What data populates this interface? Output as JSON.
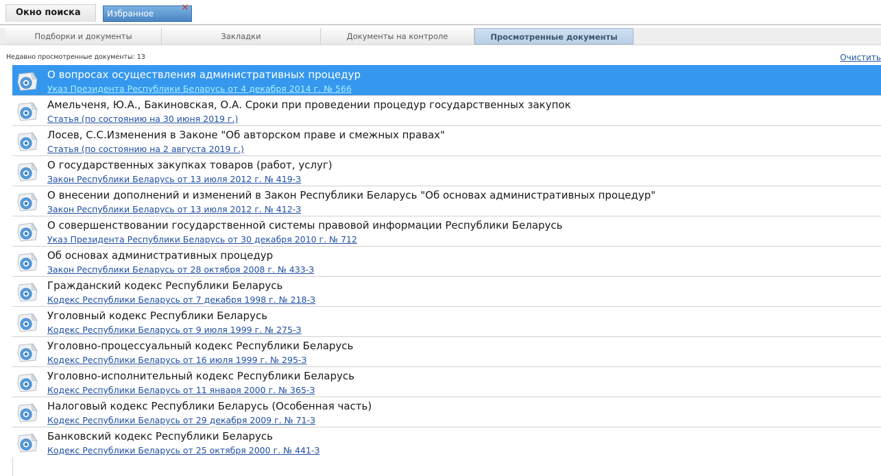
{
  "window_tabs": {
    "search": "Окно поиска",
    "favorites": "Избранное",
    "close_icon": "close-icon"
  },
  "sub_tabs": [
    {
      "label": "Подборки и документы"
    },
    {
      "label": "Закладки"
    },
    {
      "label": "Документы на контроле"
    },
    {
      "label": "Просмотренные документы",
      "active": true
    }
  ],
  "header": {
    "recent_label": "Недавно просмотренные документы: 13",
    "clear_link": "Очистить"
  },
  "documents": [
    {
      "title": "О вопросах осуществления административных процедур",
      "sub": "Указ Президента Республики Беларусь от 4 декабря 2014 г. № 566",
      "selected": true
    },
    {
      "title": "Амельченя, Ю.А., Бакиновская, О.А. Сроки при проведении процедур государственных закупок",
      "sub": "Статья (по состоянию на 30 июня 2019 г.)"
    },
    {
      "title": "Лосев, С.С.Изменения в Законе \"Об авторском праве и смежных правах\"",
      "sub": "Статья (по состоянию на 2 августа 2019 г.)"
    },
    {
      "title": "О государственных закупках товаров (работ, услуг)",
      "sub": "Закон Республики Беларусь от 13 июля 2012 г. № 419-З"
    },
    {
      "title": "О внесении дополнений и изменений в Закон Республики Беларусь \"Об основах административных процедур\"",
      "sub": "Закон Республики Беларусь от 13 июля 2012 г. № 412-З"
    },
    {
      "title": "О совершенствовании государственной системы правовой информации Республики Беларусь",
      "sub": "Указ Президента Республики Беларусь от 30 декабря 2010 г. № 712"
    },
    {
      "title": "Об основах административных процедур",
      "sub": "Закон Республики Беларусь от 28 октября 2008 г. № 433-З"
    },
    {
      "title": "Гражданский кодекс Республики Беларусь",
      "sub": "Кодекс Республики Беларусь от 7 декабря 1998 г. № 218-З"
    },
    {
      "title": "Уголовный кодекс Республики Беларусь",
      "sub": "Кодекс Республики Беларусь от 9 июля 1999 г. № 275-З"
    },
    {
      "title": "Уголовно-процессуальный кодекс Республики Беларусь",
      "sub": "Кодекс Республики Беларусь от 16 июля 1999 г. № 295-З"
    },
    {
      "title": "Уголовно-исполнительный кодекс Республики Беларусь",
      "sub": "Кодекс Республики Беларусь от 11 января 2000 г. № 365-З"
    },
    {
      "title": "Налоговый кодекс Республики Беларусь (Особенная часть)",
      "sub": "Кодекс Республики Беларусь от 29 декабря 2009 г. № 71-З"
    },
    {
      "title": "Банковский кодекс Республики Беларусь",
      "sub": "Кодекс Республики Беларусь от 25 октября 2000 г. № 441-З"
    }
  ],
  "colors": {
    "selected_row": "#3597ee",
    "link": "#1f4fa3",
    "active_tab": "#b9cfe6"
  }
}
